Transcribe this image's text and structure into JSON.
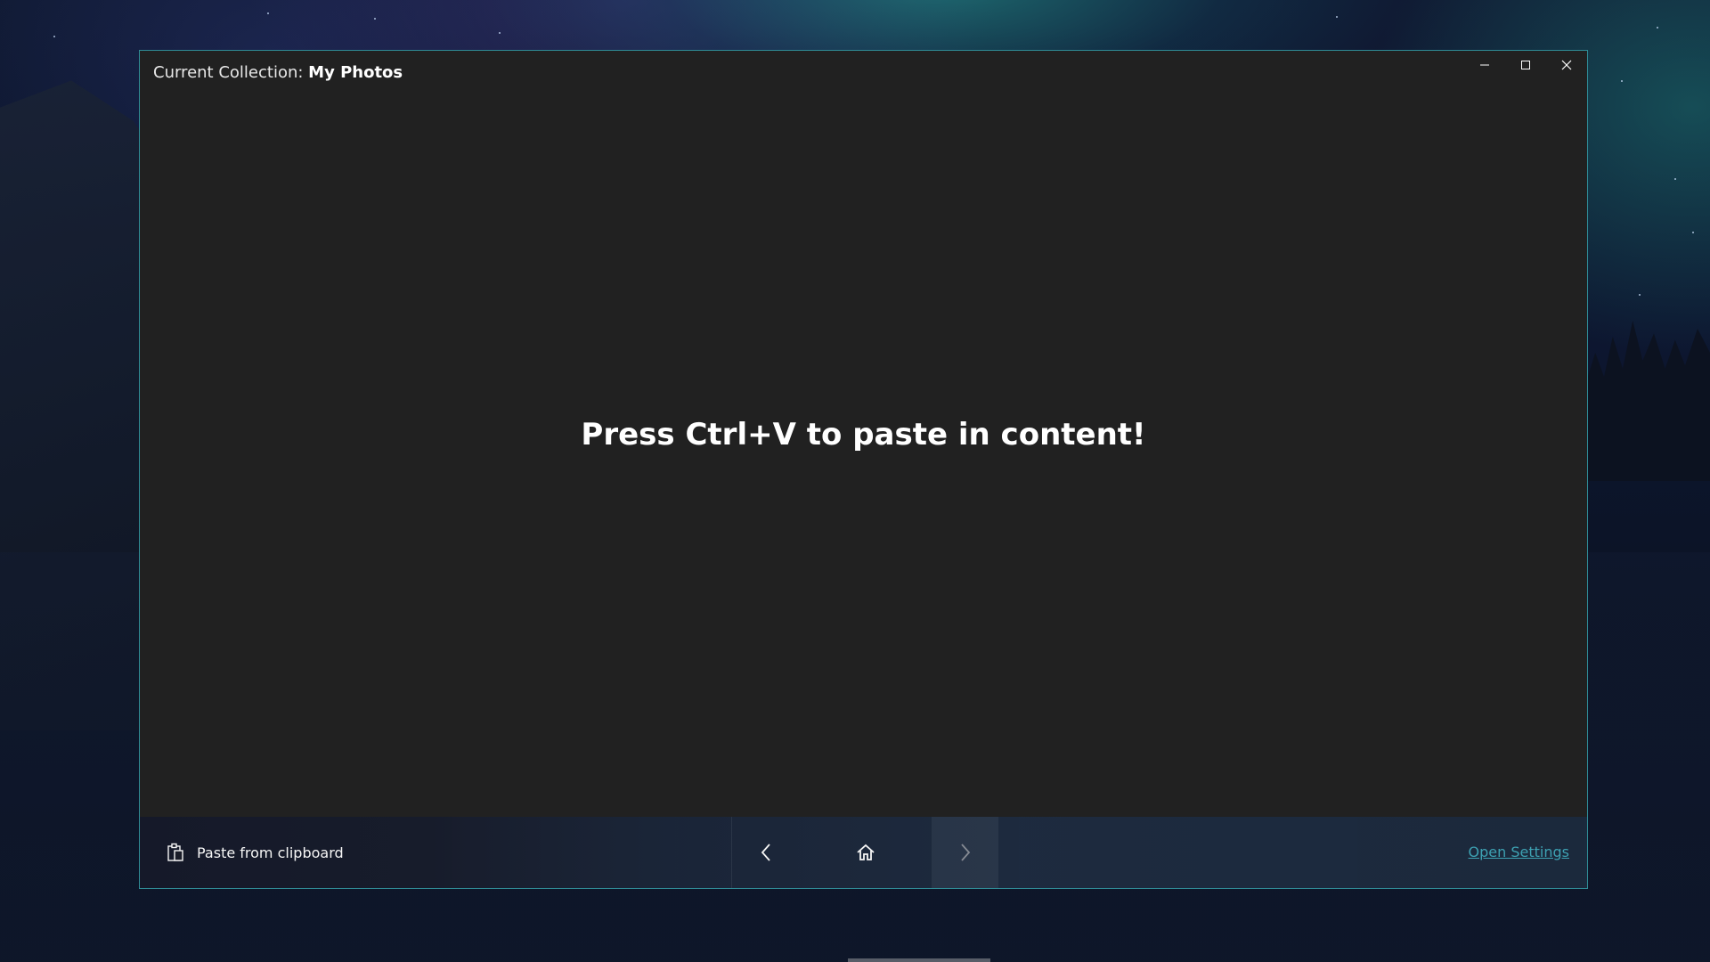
{
  "window": {
    "title_prefix": "Current Collection: ",
    "title_collection": "My Photos"
  },
  "content": {
    "message": "Press Ctrl+V to paste in content!"
  },
  "bottombar": {
    "paste_label": "Paste from clipboard",
    "settings_link": "Open Settings"
  },
  "colors": {
    "accent": "#3fa7b8",
    "window_background": "#212121",
    "window_border": "#2f8c96"
  },
  "icons": {
    "paste": "clipboard-icon",
    "back": "chevron-left-icon",
    "home": "home-icon",
    "forward": "chevron-right-icon",
    "minimize": "minimize-icon",
    "maximize": "maximize-icon",
    "close": "close-icon"
  }
}
